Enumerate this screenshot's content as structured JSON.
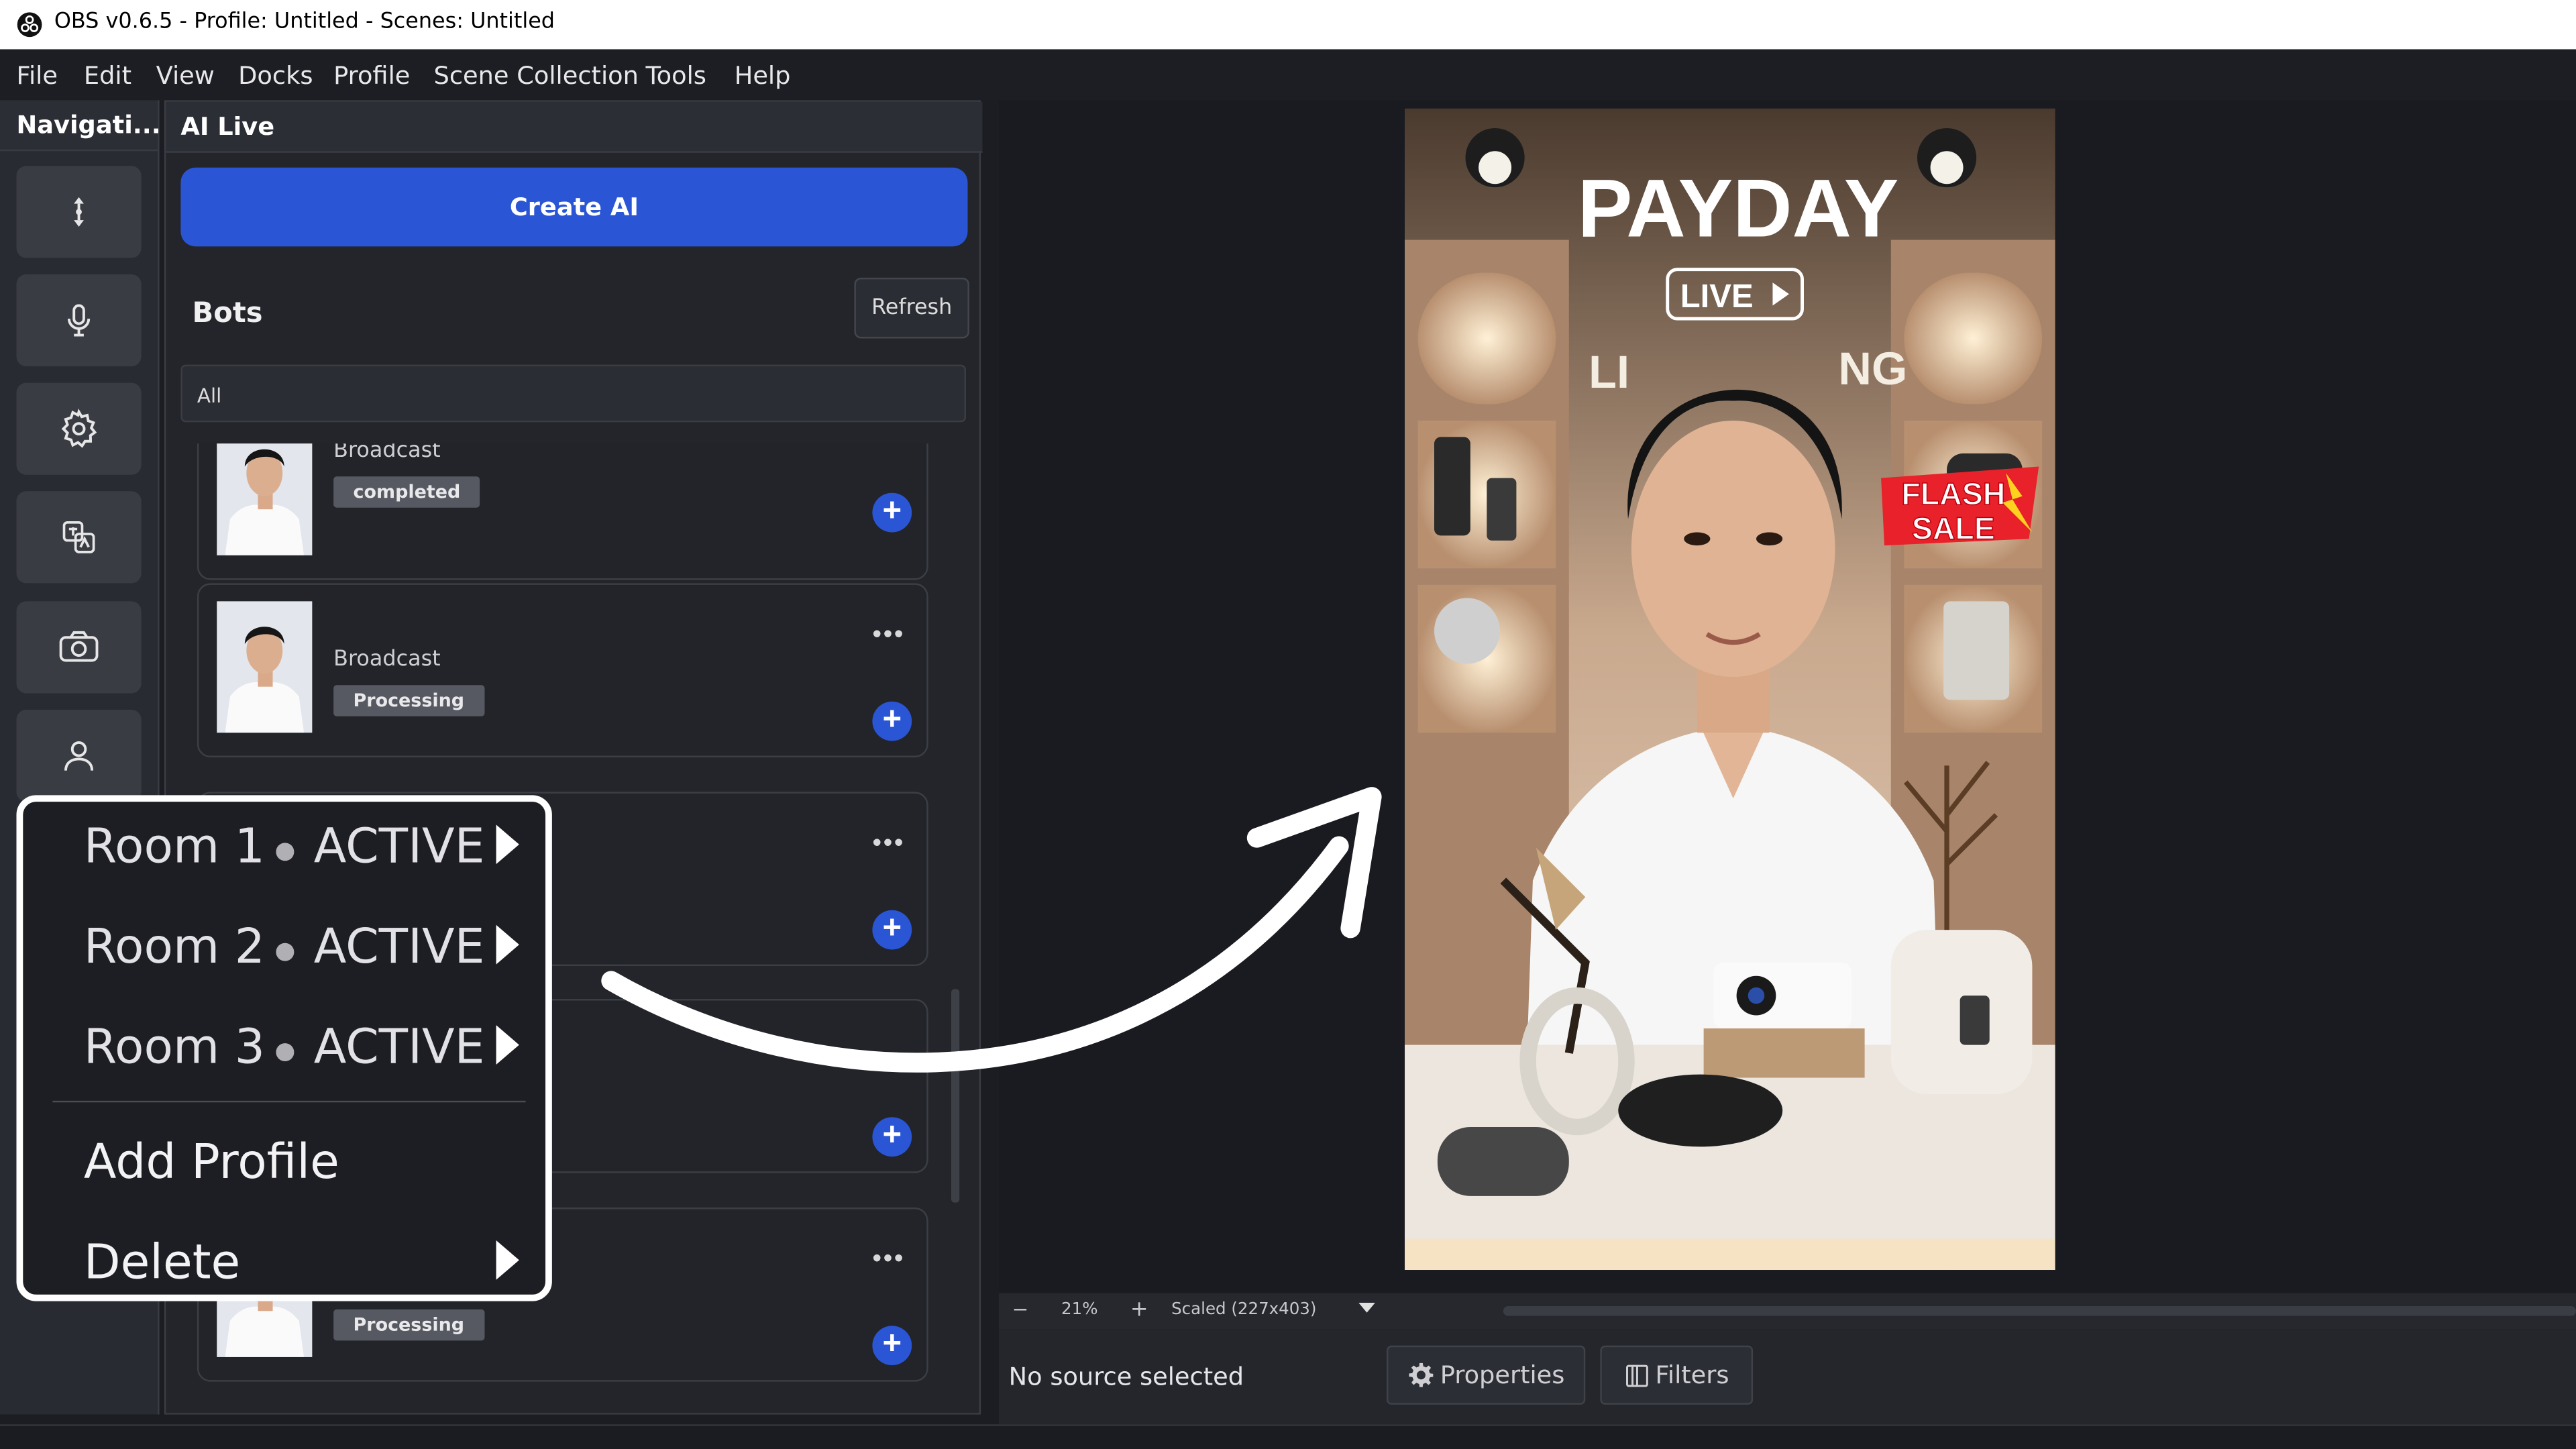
{
  "window": {
    "title": "OBS v0.6.5 - Profile: Untitled - Scenes: Untitled"
  },
  "menu": [
    "File",
    "Edit",
    "View",
    "Docks",
    "Profile",
    "Scene Collection",
    "Tools",
    "Help"
  ],
  "nav": {
    "header": "Navigati...",
    "buttons": [
      "move-arrows-icon",
      "microphone-icon",
      "gear-icon",
      "translate-icon",
      "camera-icon",
      "user-icon"
    ]
  },
  "ai_live": {
    "header": "AI Live",
    "create_label": "Create AI",
    "bots_title": "Bots",
    "refresh_label": "Refresh",
    "filter_value": "All",
    "cards": [
      {
        "name": "Broadcast",
        "status": "completed"
      },
      {
        "name": "Broadcast",
        "status": "Processing"
      },
      {
        "name": "",
        "status": ""
      },
      {
        "name": "",
        "status": ""
      },
      {
        "name": "",
        "status": "Processing"
      }
    ],
    "more_icon": "•••",
    "add_icon": "+"
  },
  "preview": {
    "headline": "PAYDAY",
    "live_badge": "LIVE",
    "partial_text_left": "LI",
    "partial_text_right": "NG",
    "flash_line1": "FLASH",
    "flash_line2": "SALE"
  },
  "zoom": {
    "minus": "−",
    "value": "21%",
    "plus": "+",
    "scaled": "Scaled (227x403)"
  },
  "source": {
    "none_label": "No source selected",
    "properties": "Properties",
    "filters": "Filters"
  },
  "context_menu": {
    "rooms": [
      {
        "label": "Room 1",
        "status": "ACTIVE"
      },
      {
        "label": "Room 2",
        "status": "ACTIVE"
      },
      {
        "label": "Room 3",
        "status": "ACTIVE"
      }
    ],
    "add_profile": "Add Profile",
    "delete": "Delete"
  },
  "colors": {
    "accent": "#2a56d6",
    "panel": "#23252b",
    "badge": "#565961"
  }
}
